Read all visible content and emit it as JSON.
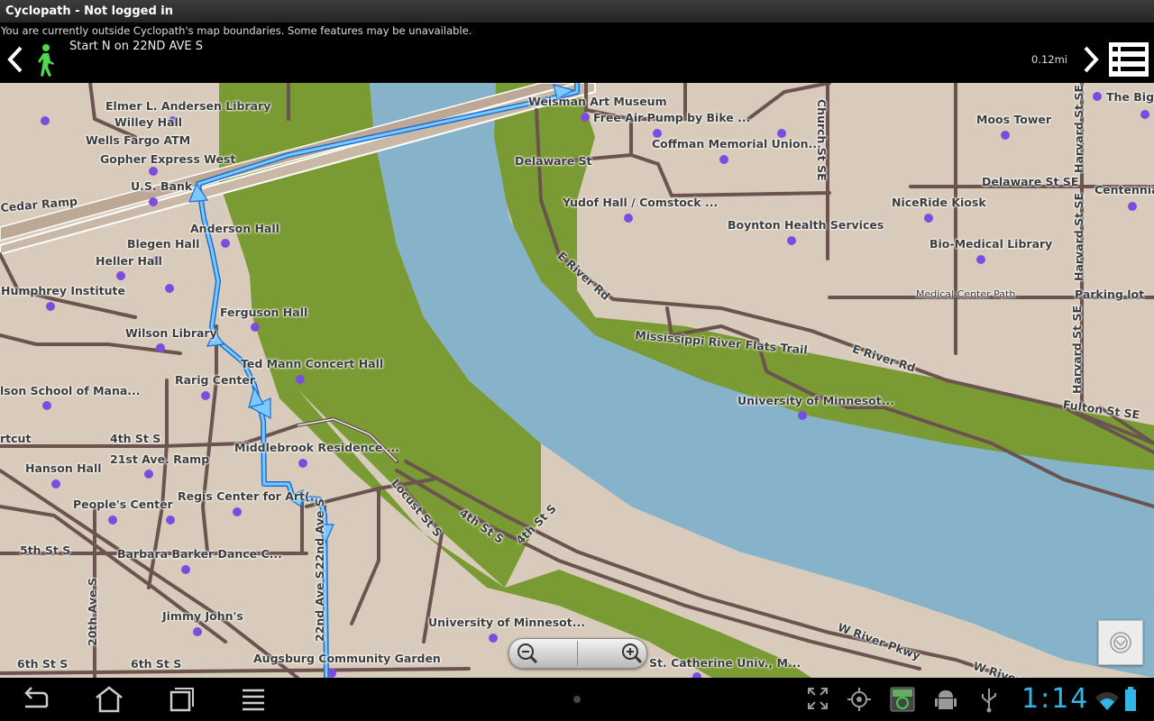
{
  "titlebar": {
    "title": "Cyclopath - Not logged in"
  },
  "directions": {
    "notice": "You are currently outside Cyclopath's map boundaries. Some features may be unavailable.",
    "step": "Start N on 22ND AVE S",
    "distance": "0.12mi",
    "mode_icon": "walker-icon"
  },
  "map": {
    "labels": {
      "elmer": "Elmer L. Andersen Library",
      "willey": "Willey Hall",
      "wells": "Wells Fargo ATM",
      "gopher": "Gopher Express West",
      "usbank": "U.S. Bank",
      "cedar": "Cedar Ramp",
      "anderson": "Anderson Hall",
      "blegen": "Blegen Hall",
      "heller": "Heller Hall",
      "humphrey": "Humphrey Institute",
      "ferguson": "Ferguson Hall",
      "wilson": "Wilson Library",
      "tedmann": "Ted Mann Concert Hall",
      "rarig": "Rarig Center",
      "carlson": "lson School of Mana...",
      "rtcut": "rtcut",
      "fourth": "4th St S",
      "middlebrook": "Middlebrook Residence ...",
      "hanson": "Hanson Hall",
      "ramp21": "21st Ave. Ramp",
      "regis": "Regis Center for Art(...",
      "peoples": "People's Center",
      "fifth": "5th St S",
      "barker": "Barbara Barker Dance C...",
      "jimmy": "Jimmy John's",
      "sixth1": "6th St S",
      "sixth2": "6th St S",
      "augsburg": "Augsburg Community Garden",
      "umn_bottom": "University of Minnesot...",
      "catherine": "St. Catherine Univ., M...",
      "weisman": "Weisman Art Museum",
      "airpump": "Free Air Pump by Bike ...",
      "coffman": "Coffman Memorial Union...",
      "delaware": "Delaware St",
      "yudof": "Yudof Hall / Comstock ...",
      "boynton": "Boynton Health Services",
      "moos": "Moos Tower",
      "thebig": "The Big",
      "delaware_se": "Delaware St SE",
      "centennial": "Centennial",
      "niceride": "NiceRide Kiosk",
      "biomed": "Bio-Medical Library",
      "medpath": "Medical Center Path",
      "parking": "Parking lot",
      "flats": "Mississippi River Flats Trail",
      "umn_mid": "University of Minnesot...",
      "fulton": "Fulton St SE",
      "eriver_rd1": "E River Rd",
      "eriver_rd2": "E River Rd",
      "church": "Church St SE",
      "harvard1": "Harvard St SE",
      "harvard2": "Harvard St SE",
      "harvard3": "Harvard St SE",
      "ave22": "22nd Ave S",
      "ave22b": "22nd Ave S",
      "ave20": "20th Ave S",
      "locust": "Locust St S",
      "fourth_b": "4th St S",
      "fourth_c": "4th St S",
      "wriver": "W River Pkwy",
      "wriver_b": "W River Pl"
    }
  },
  "controls": {
    "zoom_out_icon": "zoom-out-icon",
    "zoom_in_icon": "zoom-in-icon",
    "recenter_icon": "recenter-icon"
  },
  "system": {
    "clock": "1:14"
  },
  "colors": {
    "land": "#d8cbbb",
    "water": "#86b3ca",
    "park": "#7a9a33",
    "road": "#6b5450",
    "route": "#3aa0ec",
    "poi": "#7c4ce0",
    "clock": "#33b5e5"
  }
}
